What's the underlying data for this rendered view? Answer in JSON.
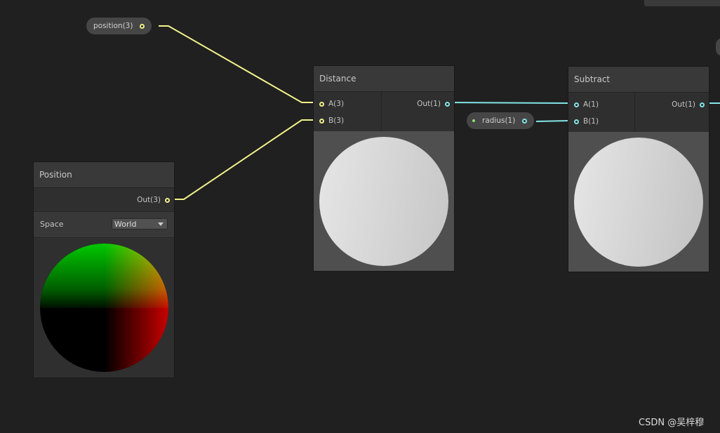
{
  "nodes": {
    "position": {
      "title": "Position",
      "output": "Out(3)",
      "space_label": "Space",
      "space_value": "World"
    },
    "distance": {
      "title": "Distance",
      "inputs": [
        "A(3)",
        "B(3)"
      ],
      "output": "Out(1)"
    },
    "subtract": {
      "title": "Subtract",
      "inputs": [
        "A(1)",
        "B(1)"
      ],
      "output": "Out(1)"
    }
  },
  "properties": {
    "position": "position(3)",
    "radius": "radius(1)"
  },
  "colors": {
    "vector3_wire": "#f2f28c",
    "float_wire": "#84e4e7",
    "background": "#202020"
  },
  "watermark": "CSDN @吴梓穆"
}
